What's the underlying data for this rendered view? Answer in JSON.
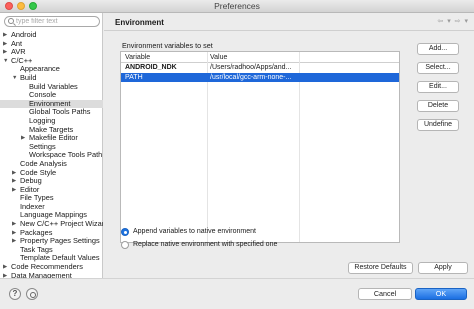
{
  "window": {
    "title": "Preferences"
  },
  "filter": {
    "placeholder": "type filter text"
  },
  "tree": [
    {
      "label": "Android",
      "level": 0,
      "arrow": "collapsed"
    },
    {
      "label": "Ant",
      "level": 0,
      "arrow": "collapsed"
    },
    {
      "label": "AVR",
      "level": 0,
      "arrow": "collapsed"
    },
    {
      "label": "C/C++",
      "level": 0,
      "arrow": "expanded"
    },
    {
      "label": "Appearance",
      "level": 1,
      "arrow": "none"
    },
    {
      "label": "Build",
      "level": 1,
      "arrow": "expanded"
    },
    {
      "label": "Build Variables",
      "level": 2,
      "arrow": "none"
    },
    {
      "label": "Console",
      "level": 2,
      "arrow": "none"
    },
    {
      "label": "Environment",
      "level": 2,
      "arrow": "none",
      "selected": true
    },
    {
      "label": "Global Tools Paths",
      "level": 2,
      "arrow": "none"
    },
    {
      "label": "Logging",
      "level": 2,
      "arrow": "none"
    },
    {
      "label": "Make Targets",
      "level": 2,
      "arrow": "none"
    },
    {
      "label": "Makefile Editor",
      "level": 2,
      "arrow": "collapsed"
    },
    {
      "label": "Settings",
      "level": 2,
      "arrow": "none"
    },
    {
      "label": "Workspace Tools Path",
      "level": 2,
      "arrow": "none"
    },
    {
      "label": "Code Analysis",
      "level": 1,
      "arrow": "none"
    },
    {
      "label": "Code Style",
      "level": 1,
      "arrow": "collapsed"
    },
    {
      "label": "Debug",
      "level": 1,
      "arrow": "collapsed"
    },
    {
      "label": "Editor",
      "level": 1,
      "arrow": "collapsed"
    },
    {
      "label": "File Types",
      "level": 1,
      "arrow": "none"
    },
    {
      "label": "Indexer",
      "level": 1,
      "arrow": "none"
    },
    {
      "label": "Language Mappings",
      "level": 1,
      "arrow": "none"
    },
    {
      "label": "New C/C++ Project Wizar",
      "level": 1,
      "arrow": "collapsed"
    },
    {
      "label": "Packages",
      "level": 1,
      "arrow": "collapsed"
    },
    {
      "label": "Property Pages Settings",
      "level": 1,
      "arrow": "collapsed"
    },
    {
      "label": "Task Tags",
      "level": 1,
      "arrow": "none"
    },
    {
      "label": "Template Default Values",
      "level": 1,
      "arrow": "none"
    },
    {
      "label": "Code Recommenders",
      "level": 0,
      "arrow": "collapsed"
    },
    {
      "label": "Data Management",
      "level": 0,
      "arrow": "collapsed"
    }
  ],
  "page": {
    "title": "Environment",
    "nav_icons": "⇦ ▾ ⇨ ▾"
  },
  "env": {
    "section_label": "Environment variables to set",
    "columns": [
      "Variable",
      "Value"
    ],
    "rows": [
      {
        "name": "ANDROID_NDK",
        "value": "/Users/radhoo/Apps/and..."
      },
      {
        "name": "PATH",
        "value": "/usr/local/gcc-arm-none-...",
        "selected": true
      }
    ]
  },
  "buttons": {
    "add": "Add...",
    "select": "Select...",
    "edit": "Edit...",
    "delete": "Delete",
    "undefine": "Undefine"
  },
  "options": {
    "append": "Append variables to native environment",
    "replace": "Replace native environment with specified one",
    "selected": "append"
  },
  "actions": {
    "restore": "Restore Defaults",
    "apply": "Apply"
  },
  "footer": {
    "cancel": "Cancel",
    "ok": "OK"
  },
  "colors": {
    "accent": "#1e67d9",
    "selection_gray": "#dcdcdc"
  },
  "icons": [
    "search-icon",
    "help-icon",
    "import-export-icon",
    "back-arrow-icon",
    "forward-arrow-icon"
  ]
}
